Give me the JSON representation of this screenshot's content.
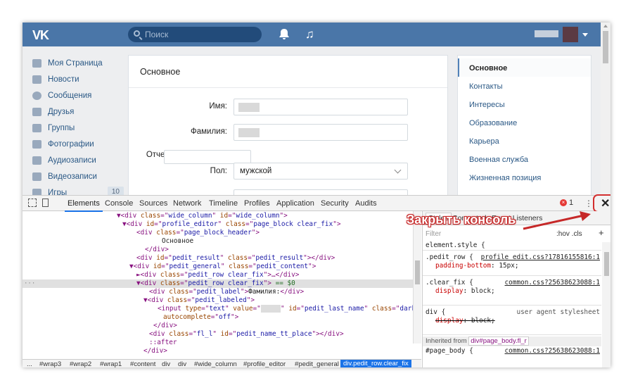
{
  "vk": {
    "logo": "VK",
    "search_placeholder": "Поиск",
    "menu": [
      {
        "label": "Моя Страница",
        "icon": "home-icon"
      },
      {
        "label": "Новости",
        "icon": "news-icon"
      },
      {
        "label": "Сообщения",
        "icon": "messages-icon"
      },
      {
        "label": "Друзья",
        "icon": "friends-icon"
      },
      {
        "label": "Группы",
        "icon": "groups-icon"
      },
      {
        "label": "Фотографии",
        "icon": "camera-icon"
      },
      {
        "label": "Аудиозаписи",
        "icon": "music-icon"
      },
      {
        "label": "Видеозаписи",
        "icon": "video-icon"
      },
      {
        "label": "Игры",
        "icon": "games-icon",
        "count": "10"
      }
    ],
    "form": {
      "title": "Основное",
      "first_name_label": "Имя:",
      "last_name_label": "Фамилия:",
      "patronymic_label": "Отчество:",
      "gender_label": "Пол:",
      "gender_value": "мужской"
    },
    "right_nav": [
      "Основное",
      "Контакты",
      "Интересы",
      "Образование",
      "Карьера",
      "Военная служба",
      "Жизненная позиция"
    ]
  },
  "devtools": {
    "tabs": [
      "Elements",
      "Console",
      "Sources",
      "Network",
      "Timeline",
      "Profiles",
      "Application",
      "Security",
      "Audits"
    ],
    "error_count": "1",
    "breadcrumbs": [
      "...",
      "#wrap3",
      "#wrap2",
      "#wrap1",
      "#content",
      "div",
      "div",
      "#wide_column",
      "#profile_editor",
      "#pedit_general",
      "div.pedit_row.clear_fix"
    ],
    "styles_tabs": [
      "Styles",
      "Computed",
      "Event Listeners"
    ],
    "filter_placeholder": "Filter",
    "hov_cls": ":hov .cls",
    "plus": "+",
    "rules": [
      {
        "selector": "element.style {",
        "source": ""
      },
      {
        "selector": ".pedit_row {",
        "source": "profile edit.css?17816155816:1",
        "prop": "padding-bottom",
        "value": "15px;"
      },
      {
        "selector": ".clear_fix {",
        "source": "common.css?25638623088:1",
        "prop": "display",
        "value": "block;"
      },
      {
        "selector": "div {",
        "source": "user agent stylesheet",
        "prop": "display",
        "value": "block;"
      }
    ],
    "inherited_from": "Inherited from",
    "inherited_node": "div#page_body.fl_r",
    "last_rule": "#page_body {",
    "last_source": "common.css?25638623088:1",
    "close_icon": "close-icon"
  },
  "annotation": "Закрыть консоль",
  "colors": {
    "vk_header": "#4a76a8",
    "accent": "#1a73e8",
    "annotation_red": "#c62828"
  }
}
